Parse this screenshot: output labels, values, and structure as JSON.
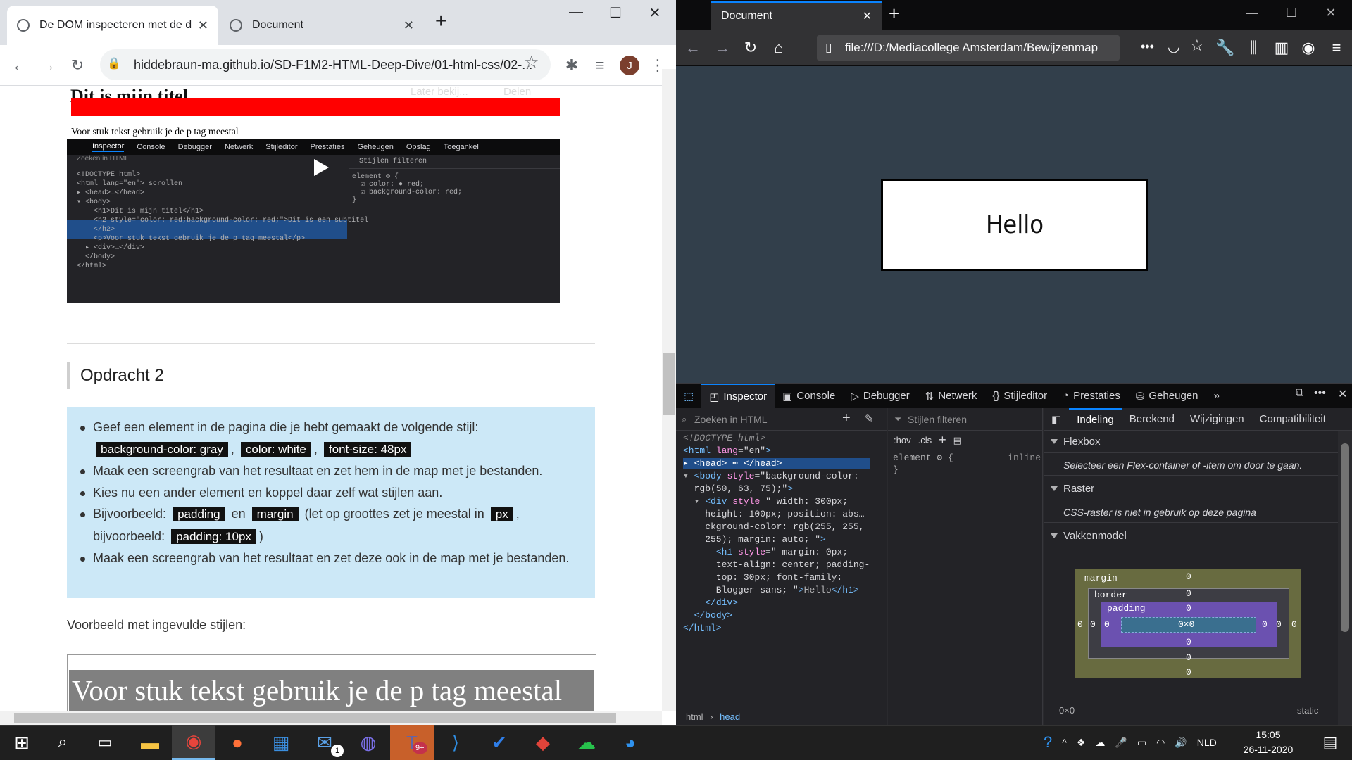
{
  "chrome": {
    "tabs": [
      {
        "title": "De DOM inspecteren met de dev"
      },
      {
        "title": "Document"
      }
    ],
    "address": "hiddebraun-ma.github.io/SD-F1M2-HTML-Deep-Dive/01-html-css/02-...",
    "avatar_letter": "J",
    "video": {
      "title": "Dit is mijn titel",
      "overlay_left": "Later bekij...",
      "overlay_right": "Delen",
      "paragraph": "Voor stuk tekst gebruik je de p tag meestal",
      "tabs": [
        "Inspector",
        "Console",
        "Debugger",
        "Netwerk",
        "Stijleditor",
        "Prestaties",
        "Geheugen",
        "Opslag",
        "Toegankel"
      ],
      "search": "Zoeken in HTML",
      "styles_search": "Stijlen filteren",
      "code": "<!DOCTYPE html>\n<html lang=\"en\"> scrollen\n▸ <head>…</head>\n▾ <body>\n    <h1>Dit is mijn titel</h1>\n    <h2 style=\"color: red;background-color: red;\">Dit is een subtitel\n    </h2>\n    <p>Voor stuk tekst gebruik je de p tag meestal</p>\n  ▸ <div>…</div>\n  </body>\n</html>",
      "rule": "element ⚙ {\n  ☑ color: ● red;\n  ☑ background-color: red;\n}"
    },
    "heading": "Opdracht 2",
    "list": {
      "item1": "Geef een element in de pagina die je hebt gemaakt de volgende stijl:",
      "code1": "background-color: gray",
      "code2": "color: white",
      "code3": "font-size: 48px",
      "item2": "Maak een screengrab van het resultaat en zet hem in de map met je bestanden.",
      "item3": "Kies nu een ander element en koppel daar zelf wat stijlen aan.",
      "item4_a": "Bijvoorbeeld:",
      "code4": "padding",
      "item4_b": "en",
      "code5": "margin",
      "item4_c": "(let op groottes zet je meestal in",
      "code6": "px",
      "item4_d": "bijvoorbeeld:",
      "code7": "padding: 10px",
      "item4_e": ")",
      "item5": "Maak een screengrab van het resultaat en zet deze ook in de map met je bestanden."
    },
    "voorbeeld": "Voorbeeld met ingevulde stijlen:",
    "example_text": "Voor stuk tekst gebruik je de p tag meestal"
  },
  "firefox": {
    "tab_title": "Document",
    "url": "file:///D:/Mediacollege Amsterdam/Bewijzenmap",
    "hello": "Hello",
    "devtools_tabs": [
      "Inspector",
      "Console",
      "Debugger",
      "Netwerk",
      "Stijleditor",
      "Prestaties",
      "Geheugen"
    ],
    "html_search": "Zoeken in HTML",
    "styles_search": "Stijlen filteren",
    "hov": ":hov",
    "cls": ".cls",
    "rule_selector": "element",
    "rule_source": "inline",
    "layout_tabs": [
      "Indeling",
      "Berekend",
      "Wijzigingen",
      "Compatibiliteit"
    ],
    "flexbox_title": "Flexbox",
    "flexbox_note": "Selecteer een Flex-container of -item om door te gaan.",
    "raster_title": "Raster",
    "raster_note": "CSS-raster is niet in gebruik op deze pagina",
    "box_title": "Vakkenmodel",
    "box_margin": "margin",
    "box_border": "border",
    "box_padding": "padding",
    "box_content": "0×0",
    "box_zero": "0",
    "box_size": "0×0",
    "box_position": "static",
    "crumbs": [
      "html",
      "head"
    ]
  },
  "taskbar": {
    "lang": "NLD",
    "time": "15:05",
    "date": "26-11-2020",
    "mail_badge": "1",
    "teams_badge": "9+"
  },
  "colors": {
    "chrome_tabbar": "#dee1e6",
    "page_bg_ff": "#323f4b",
    "devtools_bg": "#232327",
    "accent_blue": "#0a84ff",
    "note_bg": "#cce8f7",
    "red_bar": "#ff0000"
  }
}
